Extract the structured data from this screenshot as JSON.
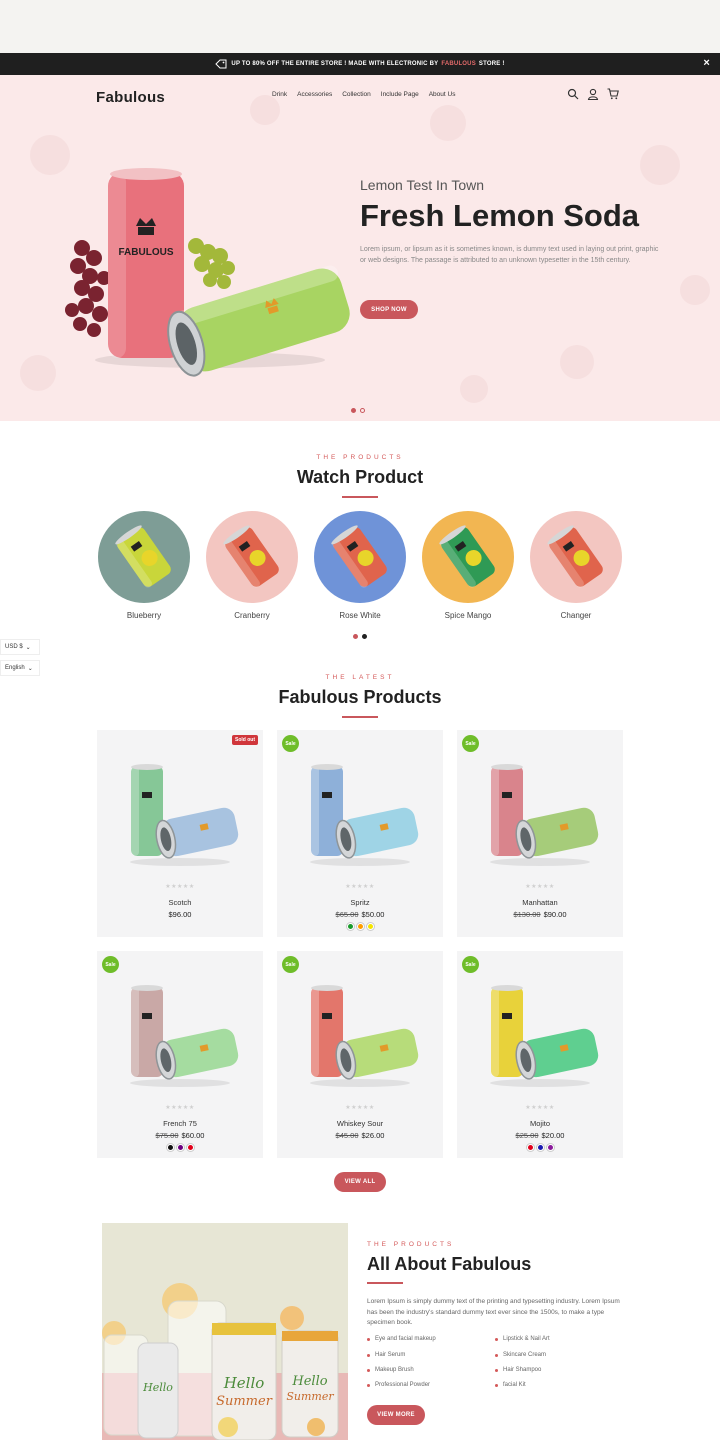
{
  "announcement": {
    "text_before": "UP TO 80% OFF THE ENTIRE STORE ! MADE WITH ELECTRONIC BY",
    "highlight": "FABULOUS",
    "text_after": "STORE !",
    "close": "×"
  },
  "header": {
    "logo": "Fabulous",
    "nav": [
      "Drink",
      "Accessories",
      "Collection",
      "Include Page",
      "About Us"
    ],
    "icons": [
      "search-icon",
      "user-icon",
      "cart-icon"
    ]
  },
  "hero": {
    "subtitle": "Lemon Test In Town",
    "title": "Fresh Lemon Soda",
    "description": "Lorem ipsum, or lipsum as it is sometimes known, is dummy text used in laying out print, graphic or web designs. The passage is attributed to an unknown typesetter in the 15th century.",
    "button": "SHOP NOW",
    "can_brand": "FABULOUS"
  },
  "categories_section": {
    "eyebrow": "THE PRODUCTS",
    "title": "Watch Product",
    "items": [
      {
        "label": "Blueberry",
        "bg": "#7e9d96",
        "can": "#c9d63a"
      },
      {
        "label": "Cranberry",
        "bg": "#f3c6c1",
        "can": "#e0644c"
      },
      {
        "label": "Rose White",
        "bg": "#6f93d8",
        "can": "#e0644c"
      },
      {
        "label": "Spice Mango",
        "bg": "#f2b652",
        "can": "#2f9a55"
      },
      {
        "label": "Changer",
        "bg": "#f3c6c1",
        "can": "#e0644c"
      }
    ]
  },
  "selectors": {
    "currency": "USD $",
    "language": "English"
  },
  "products_section": {
    "eyebrow": "THE LATEST",
    "title": "Fabulous Products",
    "view_all": "VIEW ALL",
    "products": [
      {
        "name": "Scotch",
        "price": "$96.00",
        "old_price": "",
        "badge": "Sold out",
        "badge_type": "sold",
        "rating": "★★★★★",
        "swatches": [],
        "can1": "#86c797",
        "can2": "#a8c3e0"
      },
      {
        "name": "Spritz",
        "price": "$50.00",
        "old_price": "$65.00",
        "badge": "Sale",
        "badge_type": "sale",
        "rating": "★★★★★",
        "swatches": [
          "#1a9a2c",
          "#ff9d00",
          "#f4e400"
        ],
        "can1": "#8eb0d9",
        "can2": "#9fd4e6"
      },
      {
        "name": "Manhattan",
        "price": "$90.00",
        "old_price": "$130.00",
        "badge": "Sale",
        "badge_type": "sale",
        "rating": "★★★★★",
        "swatches": [],
        "can1": "#d9848c",
        "can2": "#a6cc7a"
      },
      {
        "name": "French 75",
        "price": "$60.00",
        "old_price": "$75.00",
        "badge": "Sale",
        "badge_type": "sale",
        "rating": "★★★★★",
        "swatches": [
          "#111111",
          "#6b0080",
          "#e0001a"
        ],
        "can1": "#c9a8a6",
        "can2": "#a5dca0"
      },
      {
        "name": "Whiskey Sour",
        "price": "$26.00",
        "old_price": "$45.00",
        "badge": "Sale",
        "badge_type": "sale",
        "rating": "★★★★★",
        "swatches": [],
        "can1": "#e3766b",
        "can2": "#b7dc7a"
      },
      {
        "name": "Mojito",
        "price": "$20.00",
        "old_price": "$25.00",
        "badge": "Sale",
        "badge_type": "sale",
        "rating": "★★★★★",
        "swatches": [
          "#e0001a",
          "#1a1ab0",
          "#8a1a9a"
        ],
        "can1": "#e8d23a",
        "can2": "#5fcf90"
      }
    ]
  },
  "about": {
    "eyebrow": "THE PRODUCTS",
    "title": "All About Fabulous",
    "description": "Lorem Ipsum is simply dummy text of the printing and typesetting industry. Lorem Ipsum has been the industry's standard dummy text ever since the 1500s, to make a type specimen book.",
    "features_left": [
      "Eye and facial makeup",
      "Hair Serum",
      "Makeup Brush",
      "Professional Powder"
    ],
    "features_right": [
      "Lipstick & Nail Art",
      "Skincare Cream",
      "Hair Shampoo",
      "facial Kit"
    ],
    "button": "VIEW MORE",
    "image_text": "Hello Summer"
  },
  "colors": {
    "accent": "#c9575c",
    "sale": "#6fbd2a",
    "sold": "#d0363b"
  }
}
